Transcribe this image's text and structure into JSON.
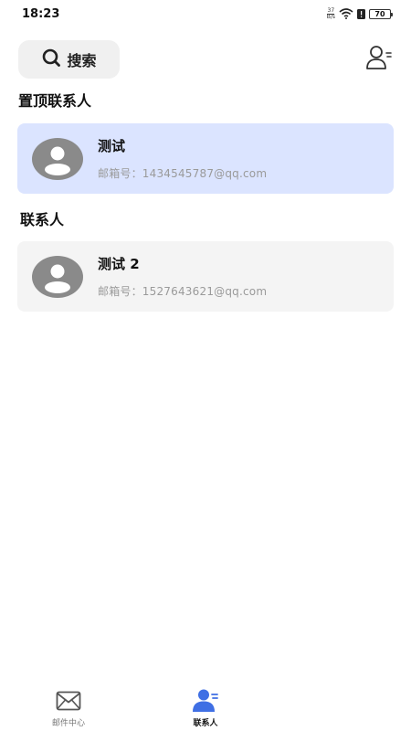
{
  "status_bar": {
    "time": "18:23",
    "net_speed_value": "37",
    "net_speed_unit": "B/s",
    "battery": "70",
    "icons": [
      "wifi-icon",
      "sim-alert-icon",
      "battery-icon"
    ]
  },
  "top_bar": {
    "search_label": "搜索",
    "search_icon": "search-icon",
    "menu_icon": "contacts-menu-icon"
  },
  "sections": {
    "pinned_title": "置顶联系人",
    "contacts_title": "联系人"
  },
  "pinned_contacts": [
    {
      "name": "测试",
      "email": "邮箱号：1434545787@qq.com"
    }
  ],
  "contacts": [
    {
      "name": "测试 2",
      "email": "邮箱号：1527643621@qq.com"
    }
  ],
  "bottom_nav": {
    "items": [
      {
        "label": "邮件中心",
        "icon": "mail-icon",
        "active": false
      },
      {
        "label": "联系人",
        "icon": "contacts-icon",
        "active": true
      }
    ]
  },
  "colors": {
    "accent": "#3f6fe4",
    "pinned_card_bg": "#dbe4ff",
    "card_bg": "#f4f4f4",
    "avatar_gray": "#8a8a8a"
  }
}
